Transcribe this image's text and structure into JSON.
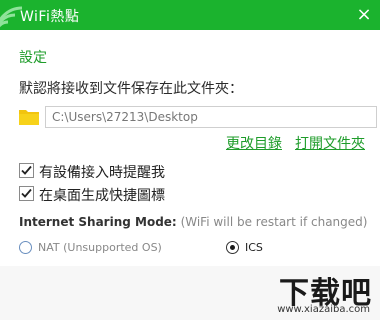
{
  "window": {
    "title": "WiFi熱點",
    "close_label": "×",
    "accent_color": "#1bb32e"
  },
  "settings": {
    "section_title": "設定",
    "save_location_label": "默認將接收到文件保存在此文件夾：",
    "folder_path": "C:\\Users\\27213\\Desktop",
    "change_dir_link": "更改目錄",
    "open_folder_link": "打開文件夾",
    "options": [
      {
        "label": "有設備接入時提醒我",
        "checked": true
      },
      {
        "label": "在桌面生成快捷圖標",
        "checked": true
      }
    ]
  },
  "sharing": {
    "mode_label": "Internet Sharing Mode:",
    "mode_hint": "(WiFi will be restart if changed)",
    "modes": [
      {
        "label": "NAT (Unsupported OS)",
        "selected": false
      },
      {
        "label": "ICS",
        "selected": true
      }
    ]
  },
  "watermark": {
    "main": "下载吧",
    "url": "www.xiazaiba.com"
  }
}
